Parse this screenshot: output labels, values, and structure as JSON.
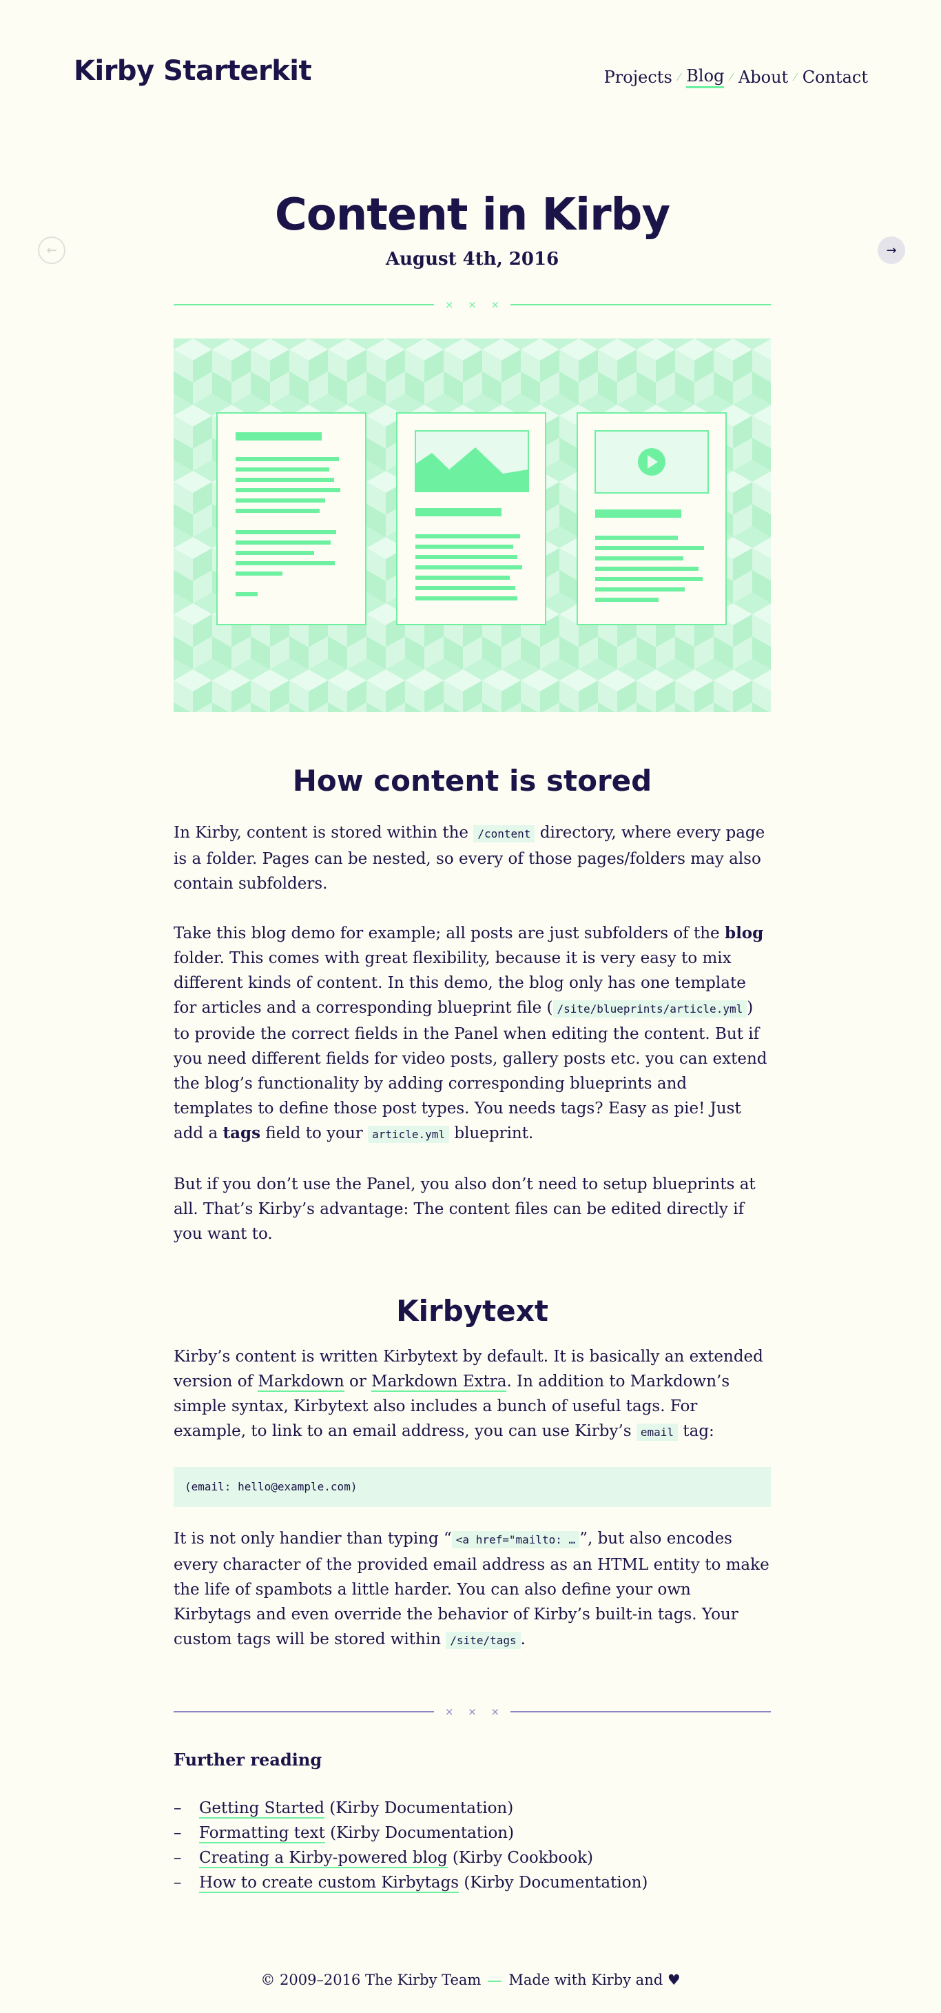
{
  "site": {
    "title": "Kirby Starterkit"
  },
  "nav": {
    "items": [
      {
        "label": "Projects",
        "active": false
      },
      {
        "label": "Blog",
        "active": true
      },
      {
        "label": "About",
        "active": false
      },
      {
        "label": "Contact",
        "active": false
      }
    ]
  },
  "pager": {
    "prev": "←",
    "next": "→"
  },
  "article": {
    "title": "Content in Kirby",
    "date": "August 4th, 2016",
    "divider": "× × ×",
    "section1": {
      "heading": "How content is stored",
      "p1": {
        "a": "In Kirby, content is stored within the ",
        "code": "/content",
        "b": " directory, where every page is a folder. Pages can be nested, so every of those pages/folders may also contain subfolders."
      },
      "p2": {
        "a": "Take this blog demo for example; all posts are just subfolders of the ",
        "strong1": "blog",
        "b": " folder. This comes with great flexibility, because it is very easy to mix different kinds of content. In this demo, the blog only has one template for articles and a corresponding blueprint file (",
        "code1": "/site/blueprints/article.yml",
        "c": ") to provide the correct fields in the Panel when editing the content. But if you need different fields for video posts, gallery posts etc. you can extend the blog’s functionality by adding corresponding blueprints and templates to define those post types. You needs tags? Easy as pie! Just add a ",
        "strong2": "tags",
        "d": " field to your ",
        "code2": "article.yml",
        "e": " blueprint."
      },
      "p3": "But if you don’t use the Panel, you also don’t need to setup blueprints at all. That’s Kirby’s advantage: The content files can be edited directly if you want to."
    },
    "section2": {
      "heading": "Kirbytext",
      "p1": {
        "a": "Kirby’s content is written Kirbytext by default. It is basically an extended version of ",
        "link1": "Markdown",
        "b": " or ",
        "link2": "Markdown Extra",
        "c": ". In addition to Markdown’s simple syntax, Kirbytext also includes a bunch of useful tags. For example, to link to an email address, you can use Kirby’s ",
        "code": "email",
        "d": " tag:"
      },
      "codeblock": "(email: hello@example.com)",
      "p2": {
        "a": "It is not only handier than typing “",
        "code1": "<a href=\"mailto: …",
        "b": "”, but also encodes every character of the provided email address as an HTML entity to make the life of spambots a little harder. You can also define your own Kirbytags and even override the behavior of Kirby’s built-in tags. Your custom tags will be stored within ",
        "code2": "/site/tags",
        "c": "."
      }
    },
    "further": {
      "title": "Further reading",
      "items": [
        {
          "link": "Getting Started",
          "source": " (Kirby Documentation)"
        },
        {
          "link": "Formatting text",
          "source": " (Kirby Documentation)"
        },
        {
          "link": "Creating a Kirby-powered blog",
          "source": " (Kirby Cookbook)"
        },
        {
          "link": "How to create custom Kirbytags",
          "source": " (Kirby Documentation)"
        }
      ]
    }
  },
  "footer": {
    "copyright": "© 2009–2016 The Kirby Team",
    "made": "Made with Kirby and ♥"
  },
  "colors": {
    "text": "#1b1448",
    "background": "#fdfdf3",
    "accent": "#6ef0a1",
    "code_bg": "#e3f8ea"
  }
}
